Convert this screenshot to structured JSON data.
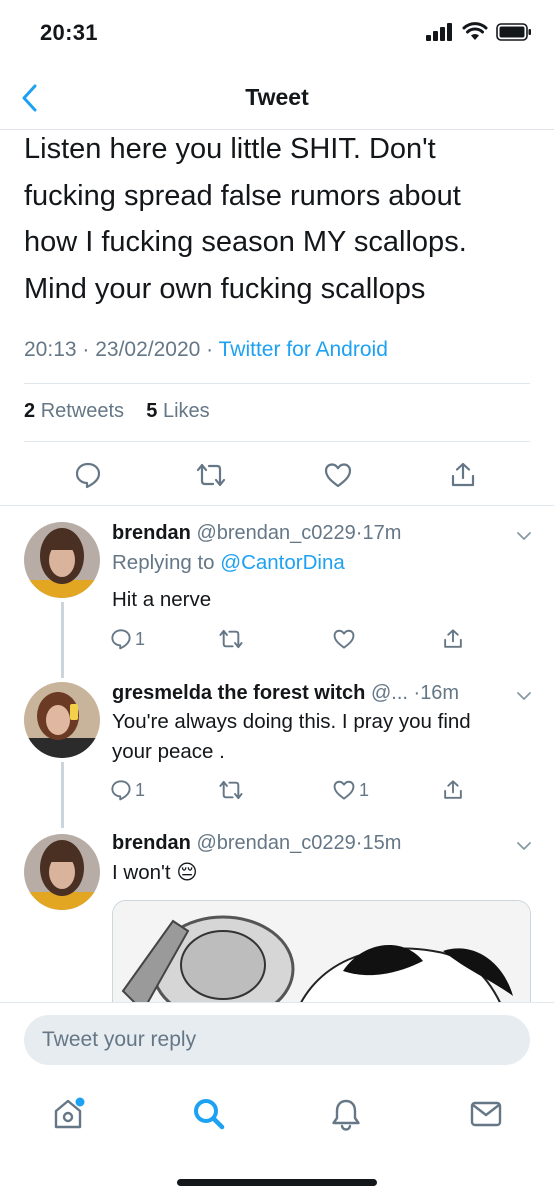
{
  "status_bar": {
    "time": "20:31"
  },
  "header": {
    "title": "Tweet"
  },
  "tweet": {
    "text_lines": [
      "Listen here you little SHIT. Don't",
      "fucking spread false rumors about",
      "how I fucking season MY scallops.",
      "Mind your own fucking scallops"
    ],
    "time": "20:13",
    "date": "23/02/2020",
    "source": "Twitter for Android",
    "retweets_count": "2",
    "retweets_label": "Retweets",
    "likes_count": "5",
    "likes_label": "Likes"
  },
  "replies": [
    {
      "name": "brendan",
      "handle": "@brendan_c0229",
      "time": "17m",
      "replying_prefix": "Replying to",
      "replying_to": "@CantorDina",
      "text": "Hit a nerve",
      "reply_count": "1",
      "retweet_count": "",
      "like_count": ""
    },
    {
      "name": "gresmelda the forest witch",
      "handle": "@...",
      "time": "16m",
      "text_lines": [
        "You're always doing this. I pray you find",
        "your peace ."
      ],
      "reply_count": "1",
      "retweet_count": "",
      "like_count": "1"
    },
    {
      "name": "brendan",
      "handle": "@brendan_c0229",
      "time": "15m",
      "text": "I won't",
      "emoji": "😔"
    }
  ],
  "compose": {
    "placeholder": "Tweet your reply"
  },
  "tab_bar": {
    "icons": [
      "home-icon",
      "search-icon",
      "notifications-icon",
      "messages-icon"
    ],
    "home_has_badge": true
  },
  "colors": {
    "accent": "#1da1f2",
    "secondary_text": "#657786",
    "primary_text": "#14171a",
    "divider": "#e1e8ed",
    "input_bg": "#e6ecf0"
  }
}
